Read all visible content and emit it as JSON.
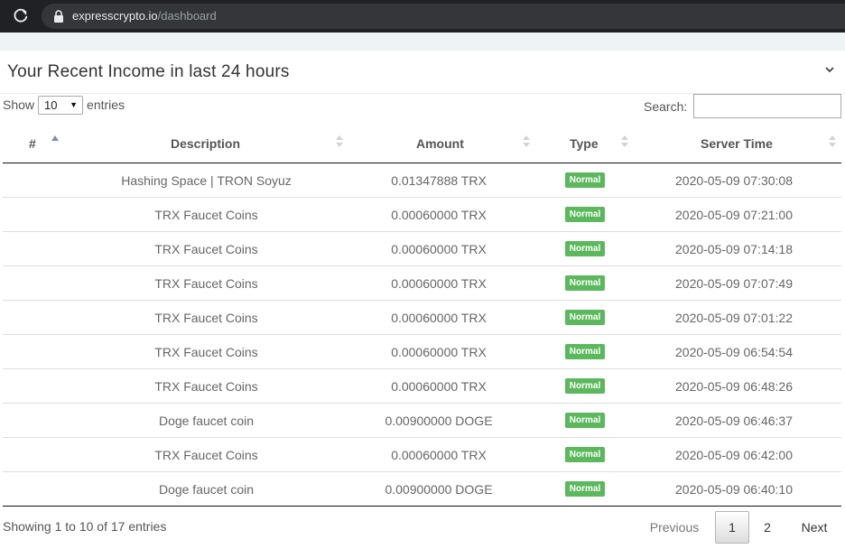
{
  "browser": {
    "url_host": "expresscrypto.io",
    "url_path": "/dashboard"
  },
  "panel": {
    "title": "Your Recent Income in last 24 hours"
  },
  "length": {
    "prefix": "Show",
    "value": "10",
    "suffix": "entries"
  },
  "search": {
    "label": "Search:",
    "value": ""
  },
  "table": {
    "columns": [
      "#",
      "Description",
      "Amount",
      "Type",
      "Server Time"
    ],
    "rows": [
      {
        "description": "Hashing Space | TRON Soyuz",
        "amount": "0.01347888 TRX",
        "type": "Normal",
        "time": "2020-05-09 07:30:08"
      },
      {
        "description": "TRX Faucet Coins",
        "amount": "0.00060000 TRX",
        "type": "Normal",
        "time": "2020-05-09 07:21:00"
      },
      {
        "description": "TRX Faucet Coins",
        "amount": "0.00060000 TRX",
        "type": "Normal",
        "time": "2020-05-09 07:14:18"
      },
      {
        "description": "TRX Faucet Coins",
        "amount": "0.00060000 TRX",
        "type": "Normal",
        "time": "2020-05-09 07:07:49"
      },
      {
        "description": "TRX Faucet Coins",
        "amount": "0.00060000 TRX",
        "type": "Normal",
        "time": "2020-05-09 07:01:22"
      },
      {
        "description": "TRX Faucet Coins",
        "amount": "0.00060000 TRX",
        "type": "Normal",
        "time": "2020-05-09 06:54:54"
      },
      {
        "description": "TRX Faucet Coins",
        "amount": "0.00060000 TRX",
        "type": "Normal",
        "time": "2020-05-09 06:48:26"
      },
      {
        "description": "Doge faucet coin",
        "amount": "0.00900000 DOGE",
        "type": "Normal",
        "time": "2020-05-09 06:46:37"
      },
      {
        "description": "TRX Faucet Coins",
        "amount": "0.00060000 TRX",
        "type": "Normal",
        "time": "2020-05-09 06:42:00"
      },
      {
        "description": "Doge faucet coin",
        "amount": "0.00900000 DOGE",
        "type": "Normal",
        "time": "2020-05-09 06:40:10"
      }
    ]
  },
  "footer": {
    "info": "Showing 1 to 10 of 17 entries",
    "previous": "Previous",
    "page1": "1",
    "page2": "2",
    "next": "Next"
  },
  "colors": {
    "badge": "#5cb85c",
    "browser_bar": "#202124"
  },
  "icons": [
    "reload-icon",
    "lock-icon",
    "chevron-down-icon",
    "sort-asc-icon",
    "sort-both-icon",
    "select-arrow-icon"
  ]
}
